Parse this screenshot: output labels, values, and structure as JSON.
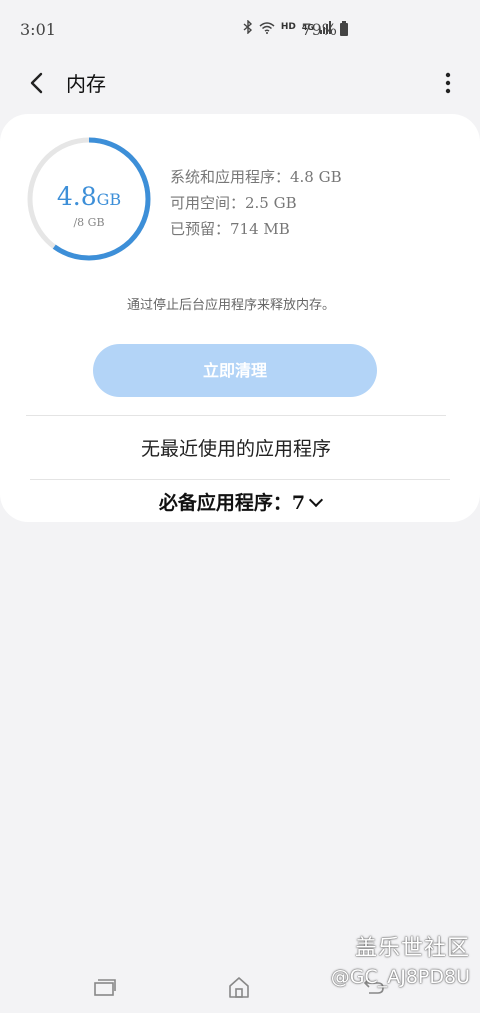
{
  "status": {
    "time": "3:01",
    "hd": "HD",
    "net": "4G",
    "battery": "79%"
  },
  "header": {
    "title": "内存"
  },
  "memory": {
    "used_value": "4.8",
    "used_unit": "GB",
    "total": "/8 GB",
    "usage_fraction": 0.6,
    "accent": "#3d8fd8",
    "stats": [
      "系统和应用程序：4.8 GB",
      "可用空间：2.5 GB",
      "已预留：714 MB"
    ]
  },
  "hint": "通过停止后台应用程序来释放内存。",
  "clean_button": "立即清理",
  "no_recent": "无最近使用的应用程序",
  "essential": "必备应用程序：7",
  "watermark": {
    "line1": "盖乐世社区",
    "line2": "@GC_AJ8PD8U"
  }
}
